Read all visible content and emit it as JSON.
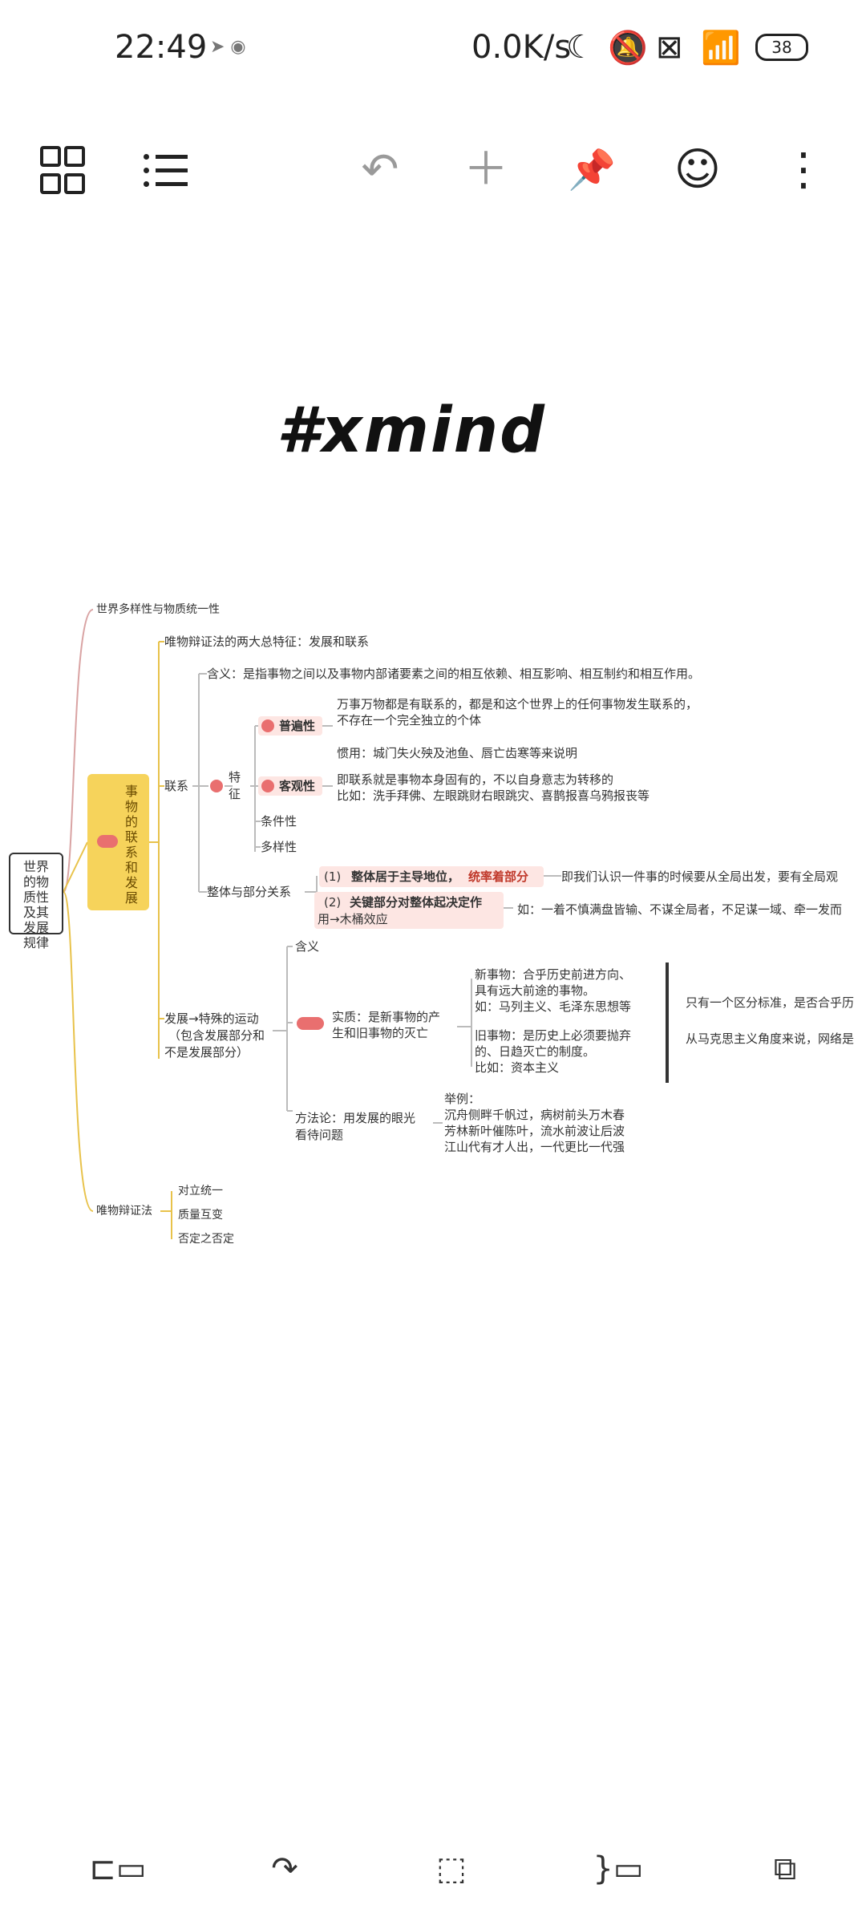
{
  "status": {
    "time": "22:49",
    "speed": "0.0K/s",
    "battery": "38"
  },
  "toolbar": {
    "icons": [
      "grid-icon",
      "list-icon",
      "undo-icon",
      "add-icon",
      "pin-icon",
      "emoji-icon",
      "more-icon"
    ]
  },
  "title": "#xmind",
  "mindmap": {
    "root": "世界的物质性及其发展规律",
    "branch_top": "世界多样性与物质统一性",
    "yellow_label": "事物的联系和发展",
    "dialectics_two": "唯物辩证法的两大总特征：发展和联系",
    "lianxi": "联系",
    "hanyi": "含义：是指事物之间以及事物内部诸要素之间的相互依赖、相互影响、相互制约和相互作用。",
    "tezheng": "特征",
    "pubianxing": "普遍性",
    "pubian_desc1": "万事万物都是有联系的，都是和这个世界上的任何事物发生联系的，",
    "pubian_desc2": "不存在一个完全独立的个体",
    "pubian_eg": "惯用：城门失火殃及池鱼、唇亡齿寒等来说明",
    "keguanxing": "客观性",
    "keguan_desc1": "即联系就是事物本身固有的，不以自身意志为转移的",
    "keguan_desc2": "比如：洗手拜佛、左眼跳财右眼跳灾、喜鹊报喜乌鸦报丧等",
    "tiaojianxing": "条件性",
    "duoyangxing": "多样性",
    "zhengti": "整体与部分关系",
    "zt1_prefix": "(1)",
    "zt1_hl1": "整体居于主导地位，",
    "zt1_hl2": "统率着部分",
    "zt1_right": "即我们认识一件事的时候要从全局出发，要有全局观",
    "zt2_prefix": "(2)",
    "zt2_hl": "关键部分对整体起决定作",
    "zt2_line2": "用→木桶效应",
    "zt2_right": "如：一着不慎满盘皆输、不谋全局者，不足谋一域、牵一发而",
    "fazhan": "发展→特殊的运动",
    "fazhan_sub": "（包含发展部分和",
    "fazhan_sub2": "不是发展部分）",
    "hanyi2": "含义",
    "shizhi": "实质：是新事物的产",
    "shizhi2": "生和旧事物的灭亡",
    "xin1": "新事物：合乎历史前进方向、",
    "xin2": "具有远大前途的事物。",
    "xin3": "如：马列主义、毛泽东思想等",
    "jiu1": "旧事物：是历史上必须要抛弃",
    "jiu2": "的、日趋灭亡的制度。",
    "jiu3": "比如：资本主义",
    "right_1": "只有一个区分标准，是否合乎历",
    "right_2": "从马克思主义角度来说，网络是",
    "fangfa1": "方法论：用发展的眼光",
    "fangfa2": "看待问题",
    "jl1": "举例：",
    "jl2": "沉舟侧畔千帆过，病树前头万木春",
    "jl3": "芳林新叶催陈叶，流水前波让后波",
    "jl4": "江山代有才人出，一代更比一代强",
    "weiwu": "唯物辩证法",
    "w1": "对立统一",
    "w2": "质量互变",
    "w3": "否定之否定"
  },
  "bottom_nav": {
    "icons": [
      "insert-topic-icon",
      "connect-icon",
      "boundary-icon",
      "summary-icon",
      "subtopic-icon"
    ]
  }
}
